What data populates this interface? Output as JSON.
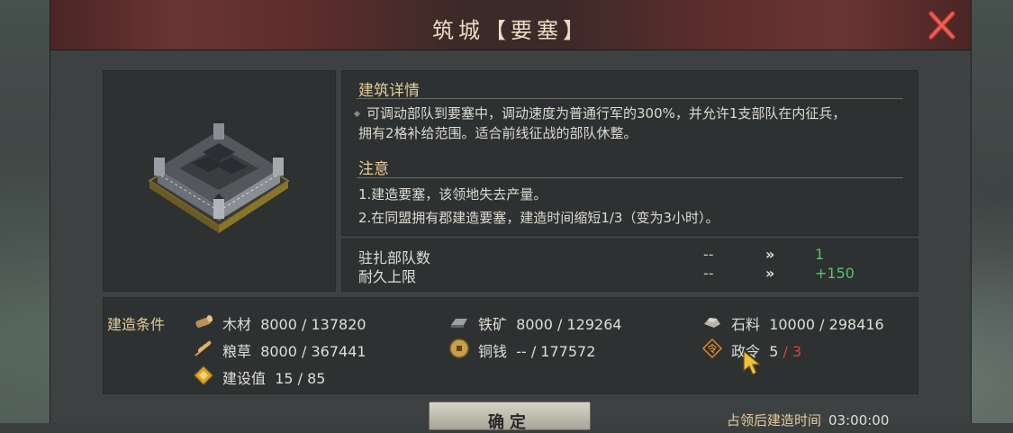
{
  "dialog": {
    "title": "筑城【要塞】"
  },
  "details": {
    "heading": "建筑详情",
    "description_line1": "可调动部队到要塞中，调动速度为普通行军的300%，并允许1支部队在内征兵，",
    "description_line2": "拥有2格补给范围。适合前线征战的部队休整。"
  },
  "notice": {
    "heading": "注意",
    "items": [
      "1.建造要塞，该领地失去产量。",
      "2.在同盟拥有郡建造要塞，建造时间缩短1/3（变为3小时）。"
    ]
  },
  "stats": [
    {
      "label": "驻扎部队数",
      "old": "--",
      "arrow": "»",
      "new": "1"
    },
    {
      "label": "耐久上限",
      "old": "--",
      "arrow": "»",
      "new": "+150"
    }
  ],
  "conditions": {
    "title": "建造条件",
    "resources": [
      {
        "icon": "wood-log-icon",
        "name": "木材",
        "value": "8000 / 137820"
      },
      {
        "icon": "iron-ingot-icon",
        "name": "铁矿",
        "value": "8000 / 129264"
      },
      {
        "icon": "stone-icon",
        "name": "石料",
        "value": "10000 / 298416"
      },
      {
        "icon": "grain-icon",
        "name": "粮草",
        "value": "8000 / 367441"
      },
      {
        "icon": "copper-coin-icon",
        "name": "铜钱",
        "value": "-- / 177572"
      },
      {
        "icon": "order-token-icon",
        "name": "政令",
        "value_current": "5",
        "value_sep": " / ",
        "value_max": "3"
      },
      {
        "icon": "construction-value-icon",
        "name": "建设值",
        "value": "15 / 85"
      }
    ]
  },
  "footer": {
    "confirm_label": "确定",
    "build_time_label": "占领后建造时间",
    "build_time_value": "03:00:00"
  },
  "colors": {
    "accent_gold": "#e6cb98",
    "increase_green": "#57c46a",
    "insufficient_red": "#d9453e",
    "title_bar": "#6a3434"
  }
}
